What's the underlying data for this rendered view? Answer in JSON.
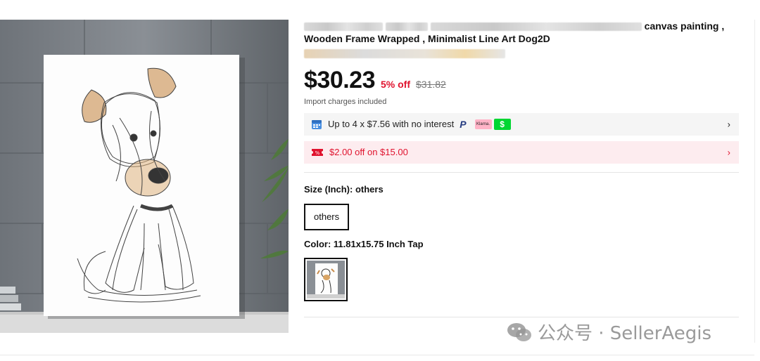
{
  "product": {
    "title_line1_suffix": "canvas painting ,",
    "title_line2": "Wooden Frame Wrapped , Minimalist Line Art Dog2D",
    "price": "$30.23",
    "discount": "5% off",
    "original_price": "$31.82",
    "import_note": "Import charges included"
  },
  "installments": {
    "text": "Up to 4 x $7.56 with no interest",
    "paypal_label": "P",
    "klarna_label": "Klarna.",
    "cashapp_label": "$",
    "chevron": "›"
  },
  "coupon": {
    "text": "$2.00 off on $15.00",
    "chevron": "›"
  },
  "size": {
    "label": "Size (Inch): others",
    "option": "others"
  },
  "color": {
    "label": "Color: 11.81x15.75 Inch Tap"
  },
  "watermark": {
    "text": "公众号 · SellerAegis"
  },
  "colors": {
    "accent_red": "#e0132e",
    "coupon_bg": "#fdecef",
    "pay_bg": "#f5f5f5",
    "cashapp_green": "#00d632",
    "klarna_pink": "#ffb3c7"
  },
  "icons": [
    "calendar-icon",
    "paypal-icon",
    "klarna-icon",
    "cashapp-icon",
    "coupon-icon",
    "chevron-right-icon",
    "wechat-icon"
  ]
}
